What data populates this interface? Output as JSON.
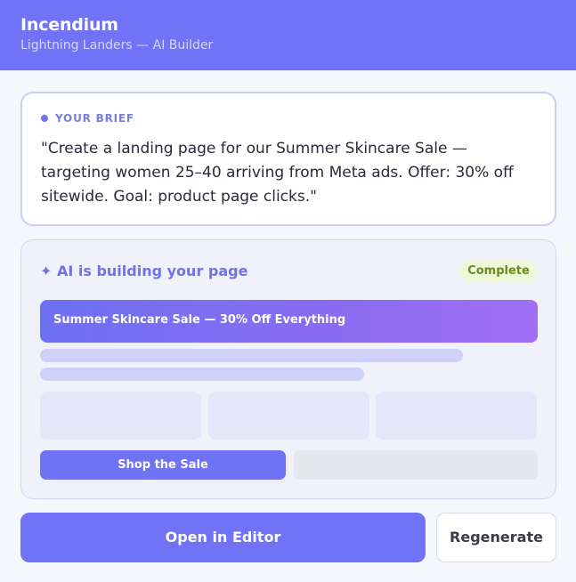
{
  "app": {
    "name": "Incendium",
    "subtitle": "Lightning Landers — AI Builder"
  },
  "brief": {
    "label": "YOUR BRIEF",
    "text": "\"Create a landing page for our Summer Skincare Sale — targeting women 25–40 arriving from Meta ads. Offer: 30% off sitewide. Goal: product page clicks.\""
  },
  "builder": {
    "title": "✦ AI is building your page",
    "status": "Complete",
    "preview": {
      "hero_title": "Summer Skincare Sale — 30% Off Everything",
      "cta_label": "Shop the Sale"
    }
  },
  "actions": {
    "open_editor": "Open in Editor",
    "regenerate": "Regenerate"
  },
  "colors": {
    "accent": "#7073f6",
    "status_complete_bg": "#eff7d9",
    "status_complete_text": "#6a8a1e"
  }
}
